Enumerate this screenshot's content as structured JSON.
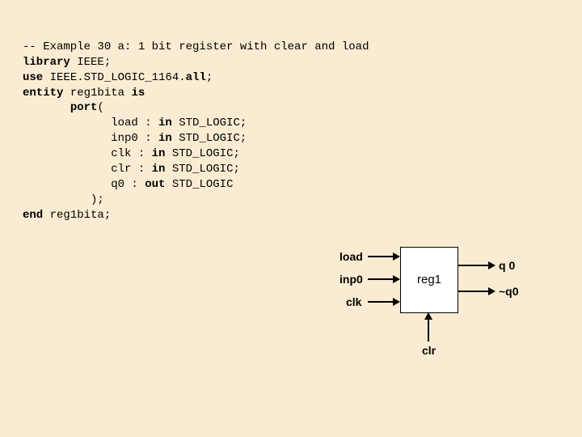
{
  "code": {
    "l1_comment": "-- Example 30 a: 1 bit register with clear and load",
    "l2_kw": "library",
    "l2_rest": " IEEE;",
    "l3_kw1": "use",
    "l3_mid": " IEEE.STD_LOGIC_1164.",
    "l3_kw2": "all",
    "l3_rest": ";",
    "l4_kw1": "entity",
    "l4_name": " reg1bita ",
    "l4_kw2": "is",
    "l5_indent": "       ",
    "l5_kw": "port",
    "l5_rest": "(",
    "l6_pre": "             load : ",
    "l6_kw": "in",
    "l6_post": " STD_LOGIC;",
    "l7_pre": "             inp0 : ",
    "l7_kw": "in",
    "l7_post": " STD_LOGIC;",
    "l8_pre": "             clk : ",
    "l8_kw": "in",
    "l8_post": " STD_LOGIC;",
    "l9_pre": "             clr : ",
    "l9_kw": "in",
    "l9_post": " STD_LOGIC;",
    "l10_pre": "             q0 : ",
    "l10_kw": "out",
    "l10_post": " STD_LOGIC",
    "l11": "          );",
    "l12_kw": "end",
    "l12_rest": " reg1bita;"
  },
  "diagram": {
    "box_label": "reg1",
    "in_load": "load",
    "in_inp0": "inp0",
    "in_clk": "clk",
    "in_clr": "clr",
    "out_q0": "q 0",
    "out_nq0": "~q0"
  }
}
